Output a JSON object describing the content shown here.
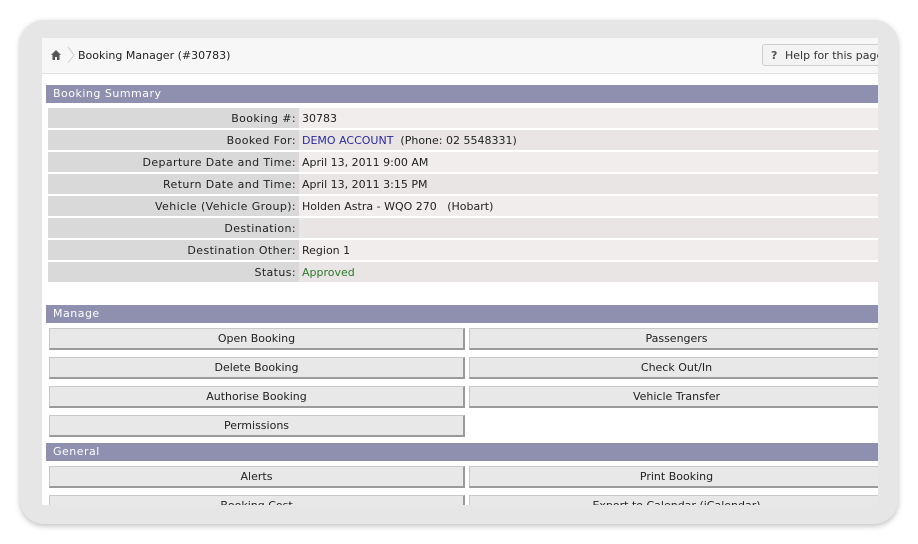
{
  "breadcrumb": {
    "home_icon": "home-icon",
    "title": "Booking Manager (#30783)"
  },
  "help": {
    "q": "?",
    "label": "Help for this page"
  },
  "summary": {
    "header": "Booking Summary",
    "rows": [
      {
        "label": "Booking #:",
        "value": "30783"
      },
      {
        "label": "Booked For:",
        "value_link": "DEMO ACCOUNT",
        "value": "(Phone: 02 5548331)"
      },
      {
        "label": "Departure Date and Time:",
        "value": "April 13, 2011 9:00 AM"
      },
      {
        "label": "Return Date and Time:",
        "value": "April 13, 2011 3:15 PM"
      },
      {
        "label": "Vehicle (Vehicle Group):",
        "value": "Holden Astra - WQO 270   (Hobart)"
      },
      {
        "label": "Destination:",
        "value": ""
      },
      {
        "label": "Destination Other:",
        "value": "Region 1"
      },
      {
        "label": "Status:",
        "value": "Approved"
      }
    ]
  },
  "manage": {
    "header": "Manage",
    "buttons": [
      "Open Booking",
      "Passengers",
      "Delete Booking",
      "Check Out/In",
      "Authorise Booking",
      "Vehicle Transfer",
      "Permissions"
    ]
  },
  "general": {
    "header": "General",
    "buttons": [
      "Alerts",
      "Print Booking",
      "Booking Cost",
      "Export to Calendar (iCalendar)"
    ]
  },
  "colors": {
    "section_header": "#8f8fb0",
    "link": "#2a2a9a",
    "status_approved": "#2b7a2b"
  }
}
